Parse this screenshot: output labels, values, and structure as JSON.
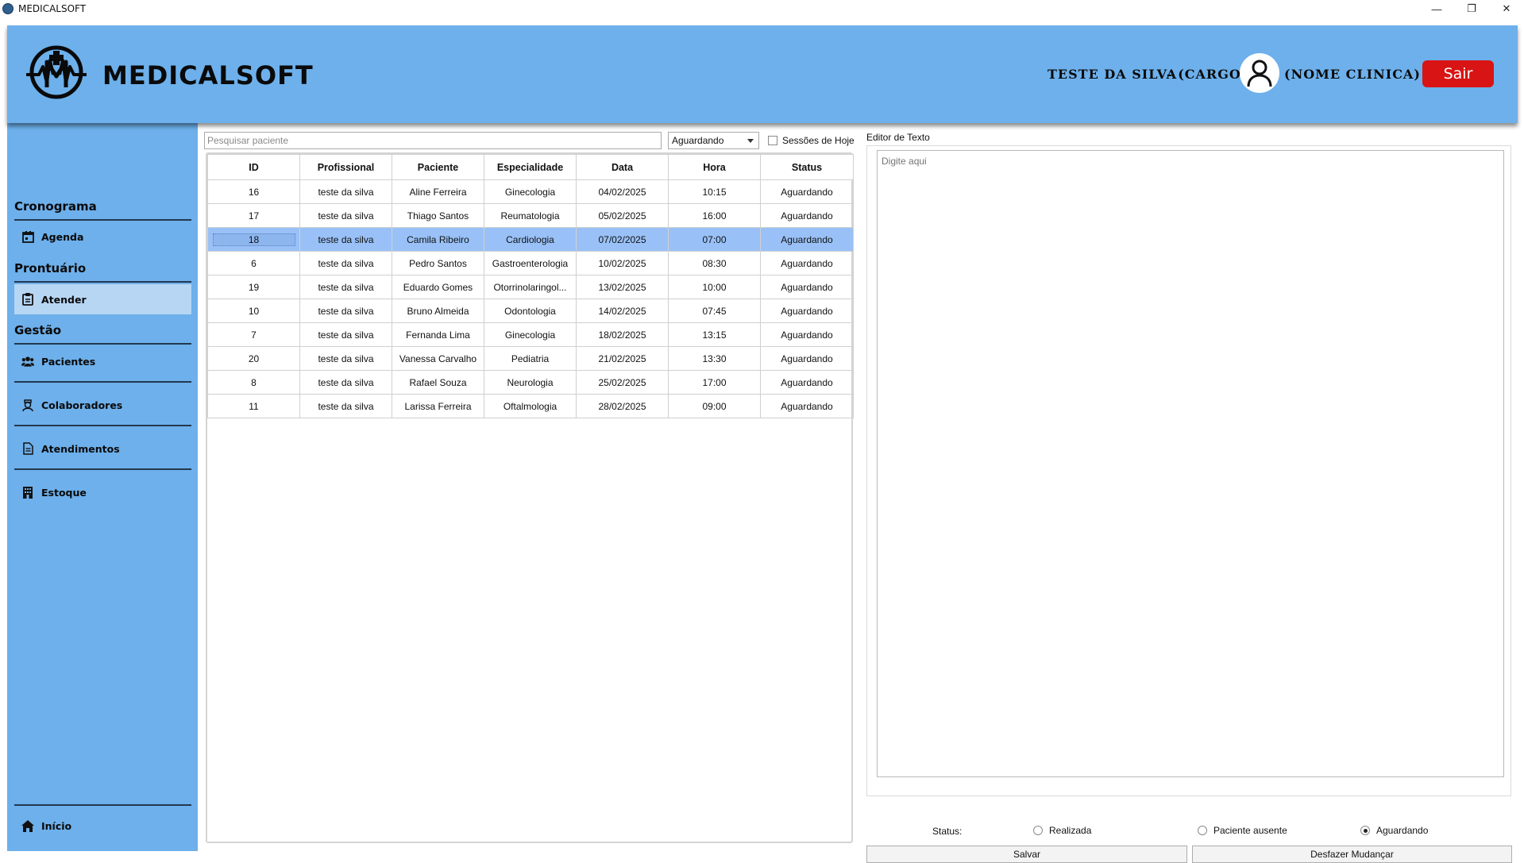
{
  "window": {
    "title": "MEDICALSOFT",
    "controls": {
      "minimize": "—",
      "restore": "❐",
      "close": "✕"
    }
  },
  "header": {
    "brand": "MEDICALSOFT",
    "user_name": "TESTE DA SILVA",
    "user_cargo": "- (CARGO)",
    "clinic_name": "(NOME CLINICA)",
    "logout_label": "Sair"
  },
  "sidebar": {
    "sections": {
      "cronograma": "Cronograma",
      "prontuario": "Prontuário",
      "gestao": "Gestão"
    },
    "items": {
      "agenda": "Agenda",
      "atender": "Atender",
      "pacientes": "Pacientes",
      "colaboradores": "Colaboradores",
      "atendimentos": "Atendimentos",
      "estoque": "Estoque",
      "inicio": "Início"
    },
    "active_item": "Atender"
  },
  "filters": {
    "search_placeholder": "Pesquisar paciente",
    "status_selected": "Aguardando",
    "today_label": "Sessões de Hoje",
    "today_checked": false
  },
  "table": {
    "columns": [
      "ID",
      "Profissional",
      "Paciente",
      "Especialidade",
      "Data",
      "Hora",
      "Status"
    ],
    "rows": [
      [
        "16",
        "teste da silva",
        "Aline Ferreira",
        "Ginecologia",
        "04/02/2025",
        "10:15",
        "Aguardando"
      ],
      [
        "17",
        "teste da silva",
        "Thiago Santos",
        "Reumatologia",
        "05/02/2025",
        "16:00",
        "Aguardando"
      ],
      [
        "18",
        "teste da silva",
        "Camila Ribeiro",
        "Cardiologia",
        "07/02/2025",
        "07:00",
        "Aguardando"
      ],
      [
        "6",
        "teste da silva",
        "Pedro Santos",
        "Gastroenterologia",
        "10/02/2025",
        "08:30",
        "Aguardando"
      ],
      [
        "19",
        "teste da silva",
        "Eduardo Gomes",
        "Otorrinolaringol...",
        "13/02/2025",
        "10:00",
        "Aguardando"
      ],
      [
        "10",
        "teste da silva",
        "Bruno Almeida",
        "Odontologia",
        "14/02/2025",
        "07:45",
        "Aguardando"
      ],
      [
        "7",
        "teste da silva",
        "Fernanda Lima",
        "Ginecologia",
        "18/02/2025",
        "13:15",
        "Aguardando"
      ],
      [
        "20",
        "teste da silva",
        "Vanessa Carvalho",
        "Pediatria",
        "21/02/2025",
        "13:30",
        "Aguardando"
      ],
      [
        "8",
        "teste da silva",
        "Rafael Souza",
        "Neurologia",
        "25/02/2025",
        "17:00",
        "Aguardando"
      ],
      [
        "11",
        "teste da silva",
        "Larissa Ferreira",
        "Oftalmologia",
        "28/02/2025",
        "09:00",
        "Aguardando"
      ]
    ],
    "selected_row": 2
  },
  "editor": {
    "label": "Editor de Texto",
    "placeholder": "Digite aqui"
  },
  "status_options": {
    "label": "Status:",
    "options": [
      "Realizada",
      "Paciente ausente",
      "Aguardando"
    ],
    "selected": "Aguardando"
  },
  "actions": {
    "save_label": "Salvar",
    "undo_label": "Desfazer Mudançar"
  },
  "colors": {
    "accent_blue": "#6db0eb",
    "selected_row": "#99c1f7",
    "active_nav": "#b7d6f3",
    "logout_red": "#d91414"
  }
}
